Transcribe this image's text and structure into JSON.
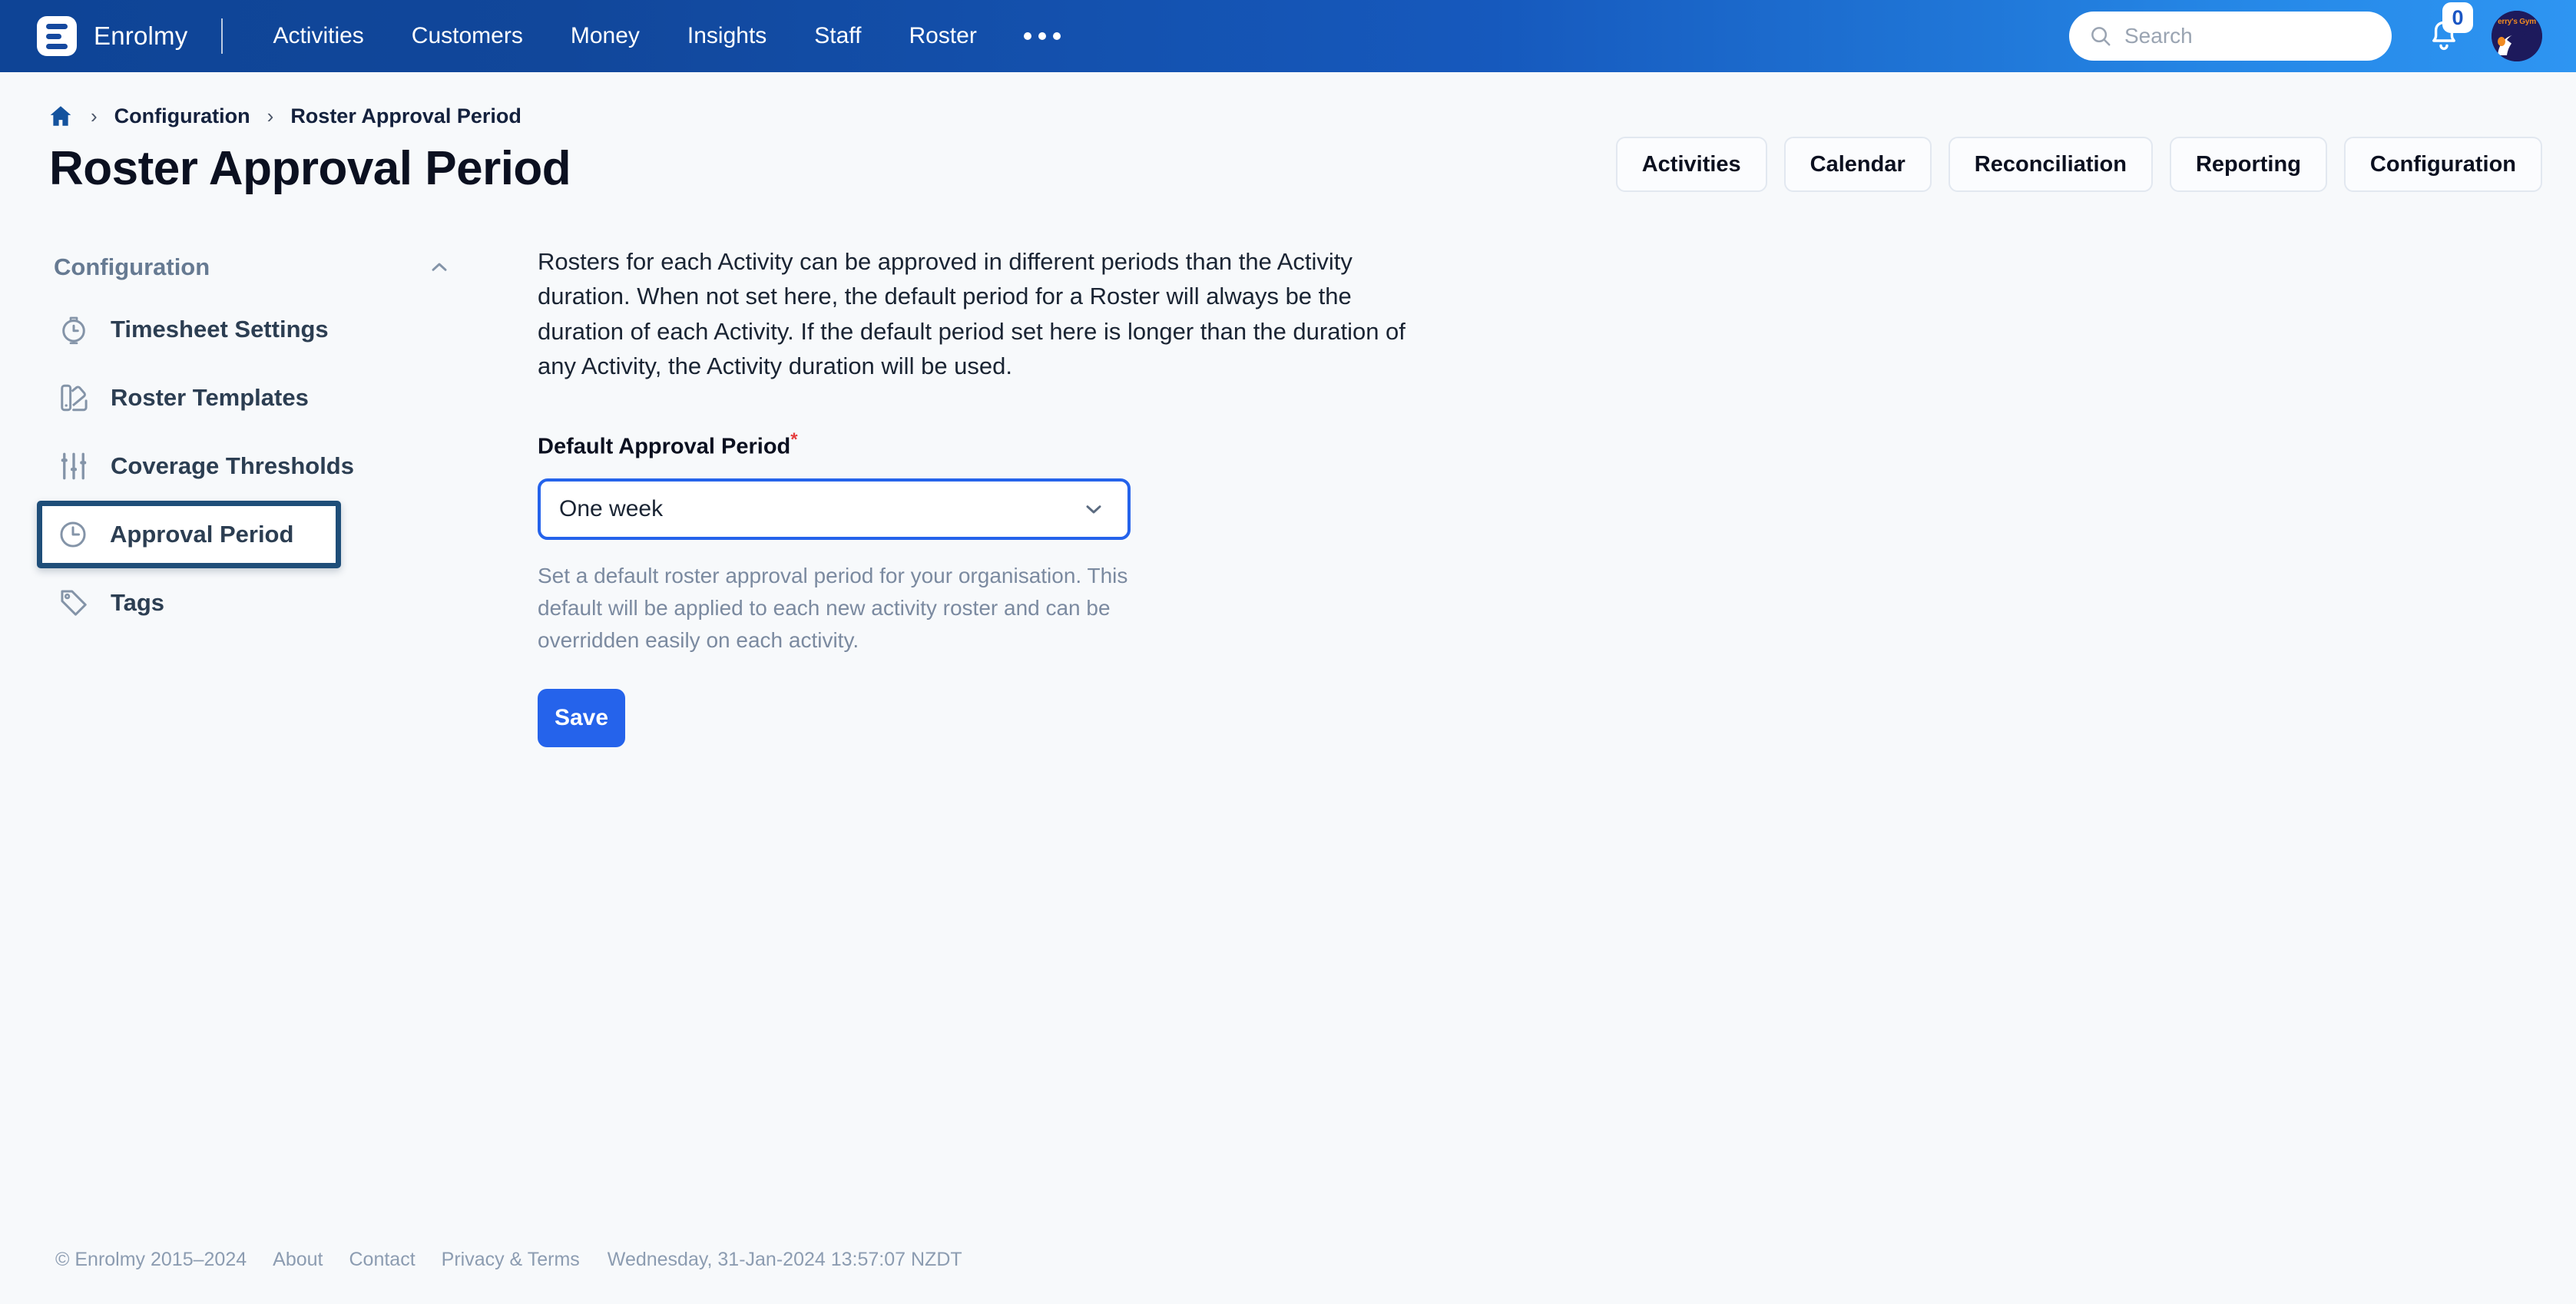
{
  "topnav": {
    "brand_name": "Enrolmy",
    "logo_icon": "enrolmy-logo-icon",
    "links": [
      {
        "label": "Activities"
      },
      {
        "label": "Customers"
      },
      {
        "label": "Money"
      },
      {
        "label": "Insights"
      },
      {
        "label": "Staff"
      },
      {
        "label": "Roster"
      }
    ],
    "more_icon": "ellipsis-icon",
    "search": {
      "icon": "search-icon",
      "placeholder": "Search",
      "value": ""
    },
    "notifications": {
      "icon": "bell-icon",
      "count": "0"
    },
    "avatar": {
      "icon": "avatar",
      "label": "erry's Gym"
    }
  },
  "header": {
    "breadcrumb": {
      "home_icon": "home-icon",
      "separator": "›",
      "items": [
        {
          "label": "Configuration"
        },
        {
          "label": "Roster Approval Period"
        }
      ]
    },
    "title": "Roster Approval Period",
    "actions": [
      {
        "label": "Activities"
      },
      {
        "label": "Calendar"
      },
      {
        "label": "Reconciliation"
      },
      {
        "label": "Reporting"
      },
      {
        "label": "Configuration"
      }
    ]
  },
  "sidebar": {
    "section_label": "Configuration",
    "collapse_icon": "chevron-up-icon",
    "items": [
      {
        "label": "Timesheet Settings",
        "icon": "stopwatch-icon",
        "selected": false
      },
      {
        "label": "Roster Templates",
        "icon": "palette-icon",
        "selected": false
      },
      {
        "label": "Coverage Thresholds",
        "icon": "sliders-icon",
        "selected": false
      },
      {
        "label": "Approval Period",
        "icon": "clock-icon",
        "selected": true
      },
      {
        "label": "Tags",
        "icon": "tag-icon",
        "selected": false
      }
    ]
  },
  "main": {
    "intro": "Rosters for each Activity can be approved in different periods than the Activity duration. When not set here, the default period for a Roster will always be the duration of each Activity. If the default period set here is longer than the duration of any Activity, the Activity duration will be used.",
    "field": {
      "label": "Default Approval Period",
      "required_marker": "*",
      "selected_value": "One week",
      "dropdown_icon": "chevron-down-icon",
      "helper_text": "Set a default roster approval period for your organisation. This default will be applied to each new activity roster and can be overridden easily on each activity."
    },
    "save_label": "Save"
  },
  "footer": {
    "copyright": "© Enrolmy  2015–2024",
    "links": [
      {
        "label": "About"
      },
      {
        "label": "Contact"
      },
      {
        "label": "Privacy & Terms"
      }
    ],
    "timestamp": "Wednesday, 31-Jan-2024 13:57:07 NZDT"
  },
  "colors": {
    "nav_start": "#0e4496",
    "nav_end": "#2e95f2",
    "accent_blue": "#2563eb",
    "highlight_navy": "#1f4e79",
    "page_bg": "#f7f9fb",
    "required_red": "#e53e3e",
    "muted_text": "#7b8aa0"
  }
}
